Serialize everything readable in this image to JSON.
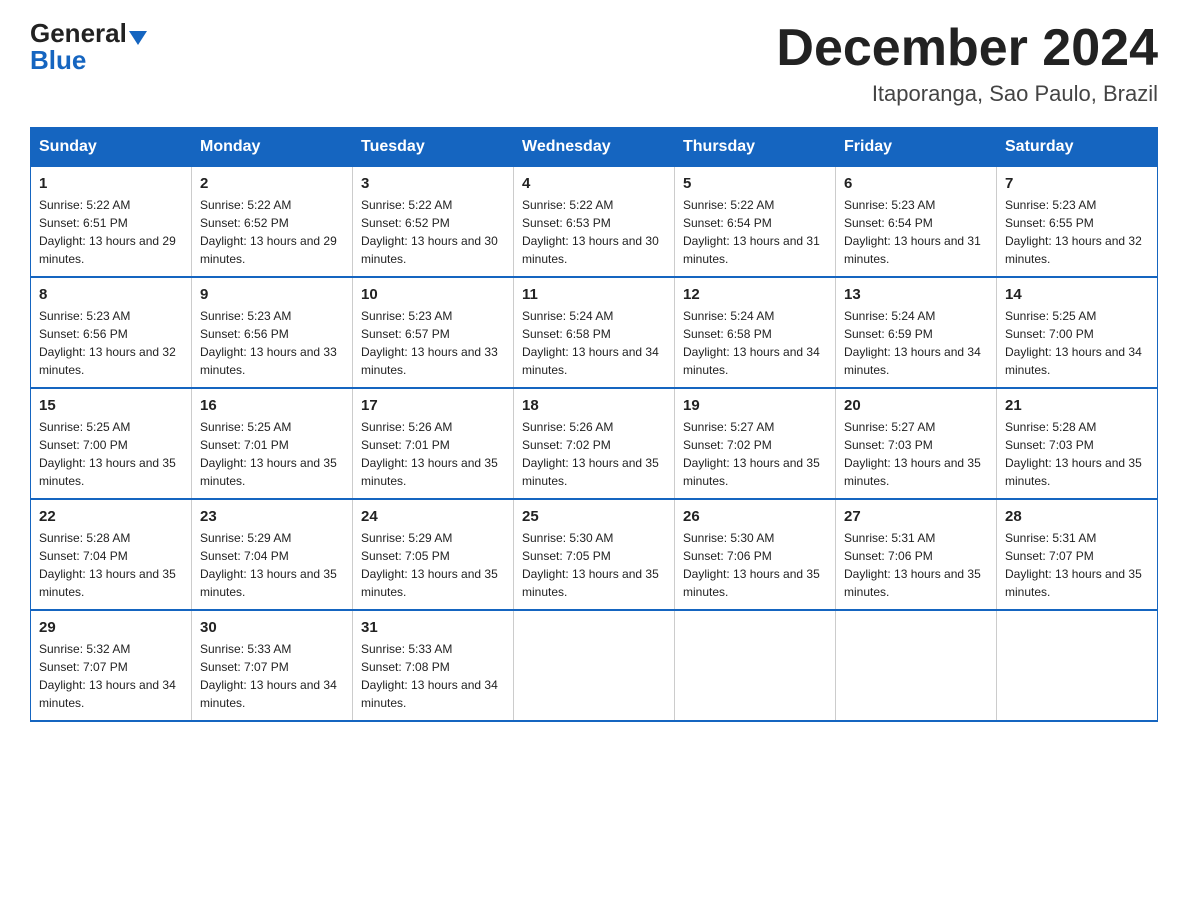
{
  "logo": {
    "general": "General",
    "blue": "Blue"
  },
  "title": "December 2024",
  "location": "Itaporanga, Sao Paulo, Brazil",
  "days_of_week": [
    "Sunday",
    "Monday",
    "Tuesday",
    "Wednesday",
    "Thursday",
    "Friday",
    "Saturday"
  ],
  "weeks": [
    [
      {
        "day": "1",
        "sunrise": "Sunrise: 5:22 AM",
        "sunset": "Sunset: 6:51 PM",
        "daylight": "Daylight: 13 hours and 29 minutes."
      },
      {
        "day": "2",
        "sunrise": "Sunrise: 5:22 AM",
        "sunset": "Sunset: 6:52 PM",
        "daylight": "Daylight: 13 hours and 29 minutes."
      },
      {
        "day": "3",
        "sunrise": "Sunrise: 5:22 AM",
        "sunset": "Sunset: 6:52 PM",
        "daylight": "Daylight: 13 hours and 30 minutes."
      },
      {
        "day": "4",
        "sunrise": "Sunrise: 5:22 AM",
        "sunset": "Sunset: 6:53 PM",
        "daylight": "Daylight: 13 hours and 30 minutes."
      },
      {
        "day": "5",
        "sunrise": "Sunrise: 5:22 AM",
        "sunset": "Sunset: 6:54 PM",
        "daylight": "Daylight: 13 hours and 31 minutes."
      },
      {
        "day": "6",
        "sunrise": "Sunrise: 5:23 AM",
        "sunset": "Sunset: 6:54 PM",
        "daylight": "Daylight: 13 hours and 31 minutes."
      },
      {
        "day": "7",
        "sunrise": "Sunrise: 5:23 AM",
        "sunset": "Sunset: 6:55 PM",
        "daylight": "Daylight: 13 hours and 32 minutes."
      }
    ],
    [
      {
        "day": "8",
        "sunrise": "Sunrise: 5:23 AM",
        "sunset": "Sunset: 6:56 PM",
        "daylight": "Daylight: 13 hours and 32 minutes."
      },
      {
        "day": "9",
        "sunrise": "Sunrise: 5:23 AM",
        "sunset": "Sunset: 6:56 PM",
        "daylight": "Daylight: 13 hours and 33 minutes."
      },
      {
        "day": "10",
        "sunrise": "Sunrise: 5:23 AM",
        "sunset": "Sunset: 6:57 PM",
        "daylight": "Daylight: 13 hours and 33 minutes."
      },
      {
        "day": "11",
        "sunrise": "Sunrise: 5:24 AM",
        "sunset": "Sunset: 6:58 PM",
        "daylight": "Daylight: 13 hours and 34 minutes."
      },
      {
        "day": "12",
        "sunrise": "Sunrise: 5:24 AM",
        "sunset": "Sunset: 6:58 PM",
        "daylight": "Daylight: 13 hours and 34 minutes."
      },
      {
        "day": "13",
        "sunrise": "Sunrise: 5:24 AM",
        "sunset": "Sunset: 6:59 PM",
        "daylight": "Daylight: 13 hours and 34 minutes."
      },
      {
        "day": "14",
        "sunrise": "Sunrise: 5:25 AM",
        "sunset": "Sunset: 7:00 PM",
        "daylight": "Daylight: 13 hours and 34 minutes."
      }
    ],
    [
      {
        "day": "15",
        "sunrise": "Sunrise: 5:25 AM",
        "sunset": "Sunset: 7:00 PM",
        "daylight": "Daylight: 13 hours and 35 minutes."
      },
      {
        "day": "16",
        "sunrise": "Sunrise: 5:25 AM",
        "sunset": "Sunset: 7:01 PM",
        "daylight": "Daylight: 13 hours and 35 minutes."
      },
      {
        "day": "17",
        "sunrise": "Sunrise: 5:26 AM",
        "sunset": "Sunset: 7:01 PM",
        "daylight": "Daylight: 13 hours and 35 minutes."
      },
      {
        "day": "18",
        "sunrise": "Sunrise: 5:26 AM",
        "sunset": "Sunset: 7:02 PM",
        "daylight": "Daylight: 13 hours and 35 minutes."
      },
      {
        "day": "19",
        "sunrise": "Sunrise: 5:27 AM",
        "sunset": "Sunset: 7:02 PM",
        "daylight": "Daylight: 13 hours and 35 minutes."
      },
      {
        "day": "20",
        "sunrise": "Sunrise: 5:27 AM",
        "sunset": "Sunset: 7:03 PM",
        "daylight": "Daylight: 13 hours and 35 minutes."
      },
      {
        "day": "21",
        "sunrise": "Sunrise: 5:28 AM",
        "sunset": "Sunset: 7:03 PM",
        "daylight": "Daylight: 13 hours and 35 minutes."
      }
    ],
    [
      {
        "day": "22",
        "sunrise": "Sunrise: 5:28 AM",
        "sunset": "Sunset: 7:04 PM",
        "daylight": "Daylight: 13 hours and 35 minutes."
      },
      {
        "day": "23",
        "sunrise": "Sunrise: 5:29 AM",
        "sunset": "Sunset: 7:04 PM",
        "daylight": "Daylight: 13 hours and 35 minutes."
      },
      {
        "day": "24",
        "sunrise": "Sunrise: 5:29 AM",
        "sunset": "Sunset: 7:05 PM",
        "daylight": "Daylight: 13 hours and 35 minutes."
      },
      {
        "day": "25",
        "sunrise": "Sunrise: 5:30 AM",
        "sunset": "Sunset: 7:05 PM",
        "daylight": "Daylight: 13 hours and 35 minutes."
      },
      {
        "day": "26",
        "sunrise": "Sunrise: 5:30 AM",
        "sunset": "Sunset: 7:06 PM",
        "daylight": "Daylight: 13 hours and 35 minutes."
      },
      {
        "day": "27",
        "sunrise": "Sunrise: 5:31 AM",
        "sunset": "Sunset: 7:06 PM",
        "daylight": "Daylight: 13 hours and 35 minutes."
      },
      {
        "day": "28",
        "sunrise": "Sunrise: 5:31 AM",
        "sunset": "Sunset: 7:07 PM",
        "daylight": "Daylight: 13 hours and 35 minutes."
      }
    ],
    [
      {
        "day": "29",
        "sunrise": "Sunrise: 5:32 AM",
        "sunset": "Sunset: 7:07 PM",
        "daylight": "Daylight: 13 hours and 34 minutes."
      },
      {
        "day": "30",
        "sunrise": "Sunrise: 5:33 AM",
        "sunset": "Sunset: 7:07 PM",
        "daylight": "Daylight: 13 hours and 34 minutes."
      },
      {
        "day": "31",
        "sunrise": "Sunrise: 5:33 AM",
        "sunset": "Sunset: 7:08 PM",
        "daylight": "Daylight: 13 hours and 34 minutes."
      },
      {
        "day": "",
        "sunrise": "",
        "sunset": "",
        "daylight": ""
      },
      {
        "day": "",
        "sunrise": "",
        "sunset": "",
        "daylight": ""
      },
      {
        "day": "",
        "sunrise": "",
        "sunset": "",
        "daylight": ""
      },
      {
        "day": "",
        "sunrise": "",
        "sunset": "",
        "daylight": ""
      }
    ]
  ]
}
